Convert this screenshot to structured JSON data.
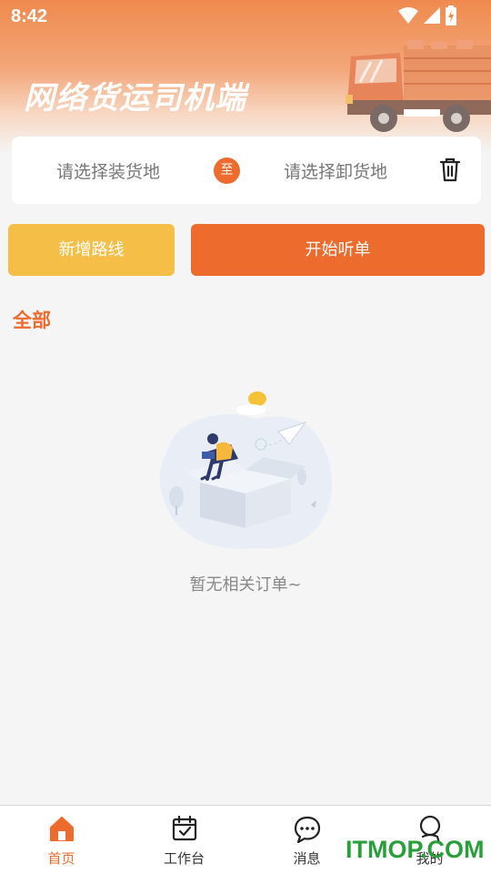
{
  "status_bar": {
    "time": "8:42"
  },
  "header": {
    "title": "网络货运司机端"
  },
  "route": {
    "from_placeholder": "请选择装货地",
    "separator": "至",
    "to_placeholder": "请选择卸货地"
  },
  "actions": {
    "add_route": "新增路线",
    "start_listening": "开始听单"
  },
  "section": {
    "title": "全部"
  },
  "empty_state": {
    "text": "暂无相关订单~"
  },
  "bottom_nav": {
    "items": [
      {
        "label": "首页",
        "icon": "home-icon",
        "active": true
      },
      {
        "label": "工作台",
        "icon": "calendar-check-icon",
        "active": false
      },
      {
        "label": "消息",
        "icon": "chat-bubble-icon",
        "active": false
      },
      {
        "label": "我的",
        "icon": "user-icon",
        "active": false
      }
    ]
  },
  "watermark": "ITMOP.COM",
  "colors": {
    "accent": "#ee6b2e",
    "secondary": "#f5bf47",
    "watermark": "#2a9e3a"
  }
}
